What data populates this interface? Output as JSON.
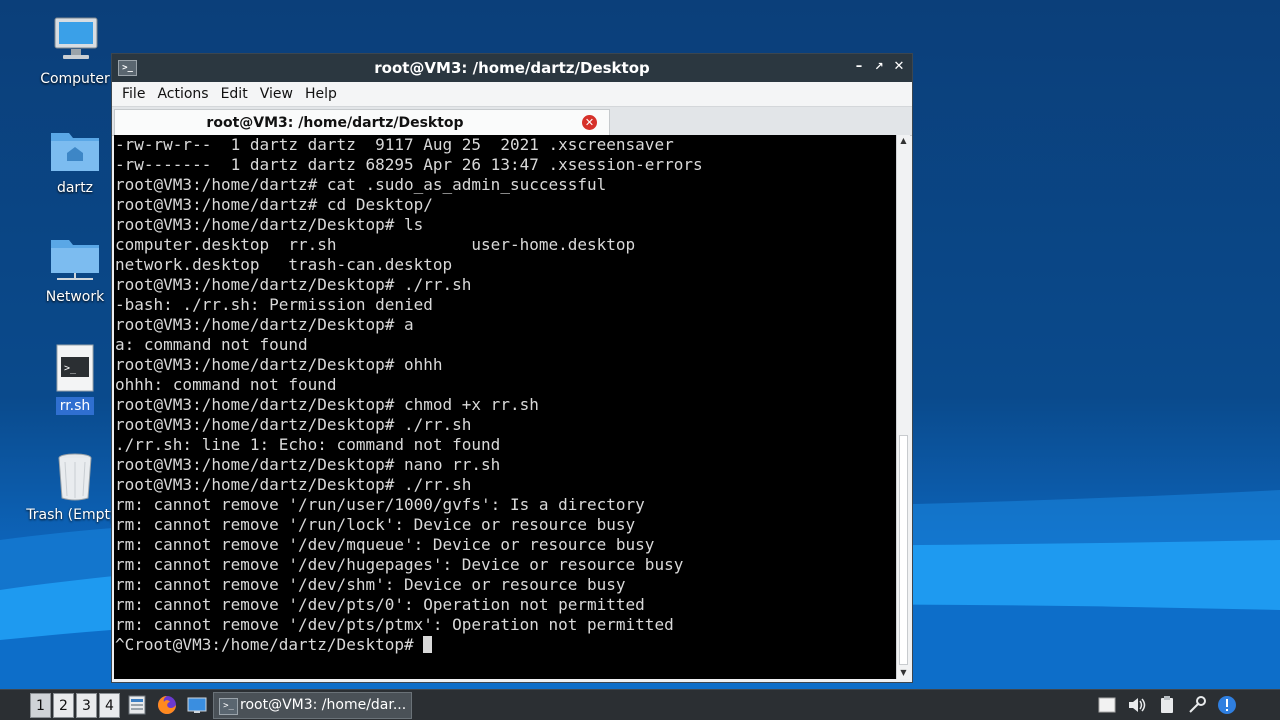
{
  "desktop": {
    "icons": [
      {
        "label": "Computer",
        "icon": "computer-icon"
      },
      {
        "label": "dartz",
        "icon": "home-folder-icon"
      },
      {
        "label": "Network",
        "icon": "network-folder-icon"
      },
      {
        "label": "rr.sh",
        "icon": "shell-script-icon",
        "selected": true
      },
      {
        "label": "Trash (Empty)",
        "icon": "trash-icon"
      }
    ]
  },
  "window": {
    "title": "root@VM3: /home/dartz/Desktop",
    "menu": [
      "File",
      "Actions",
      "Edit",
      "View",
      "Help"
    ],
    "tab_label": "root@VM3: /home/dartz/Desktop",
    "terminal_lines": [
      "-rw-rw-r--  1 dartz dartz  9117 Aug 25  2021 .xscreensaver",
      "-rw-------  1 dartz dartz 68295 Apr 26 13:47 .xsession-errors",
      "root@VM3:/home/dartz# cat .sudo_as_admin_successful",
      "root@VM3:/home/dartz# cd Desktop/",
      "root@VM3:/home/dartz/Desktop# ls",
      "computer.desktop  rr.sh              user-home.desktop",
      "network.desktop   trash-can.desktop",
      "root@VM3:/home/dartz/Desktop# ./rr.sh",
      "-bash: ./rr.sh: Permission denied",
      "root@VM3:/home/dartz/Desktop# a",
      "a: command not found",
      "root@VM3:/home/dartz/Desktop# ohhh",
      "ohhh: command not found",
      "root@VM3:/home/dartz/Desktop# chmod +x rr.sh",
      "root@VM3:/home/dartz/Desktop# ./rr.sh",
      "./rr.sh: line 1: Echo: command not found",
      "root@VM3:/home/dartz/Desktop# nano rr.sh",
      "root@VM3:/home/dartz/Desktop# ./rr.sh",
      "rm: cannot remove '/run/user/1000/gvfs': Is a directory",
      "rm: cannot remove '/run/lock': Device or resource busy",
      "rm: cannot remove '/dev/mqueue': Device or resource busy",
      "rm: cannot remove '/dev/hugepages': Device or resource busy",
      "rm: cannot remove '/dev/shm': Device or resource busy",
      "rm: cannot remove '/dev/pts/0': Operation not permitted",
      "rm: cannot remove '/dev/pts/ptmx': Operation not permitted"
    ],
    "prompt_line": "^Croot@VM3:/home/dartz/Desktop# "
  },
  "taskbar": {
    "workspaces": [
      "1",
      "2",
      "3",
      "4"
    ],
    "task_label": "root@VM3: /home/dar..."
  }
}
